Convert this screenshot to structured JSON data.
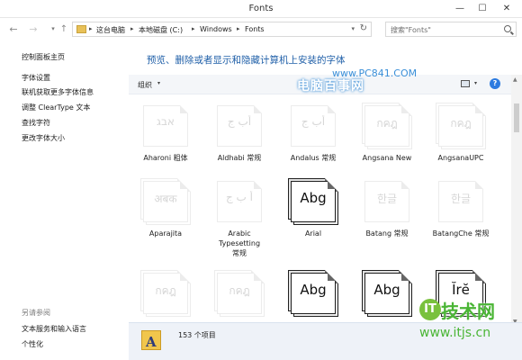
{
  "window": {
    "title": "Fonts",
    "minimize_glyph": "—",
    "maximize_glyph": "☐",
    "close_glyph": "✕"
  },
  "nav": {
    "back_glyph": "←",
    "forward_glyph": "→",
    "recent_glyph": "▾",
    "up_glyph": "↑",
    "breadcrumb": [
      "这台电脑",
      "本地磁盘 (C:)",
      "Windows",
      "Fonts"
    ],
    "separator_glyph": "▸",
    "dropdown_glyph": "▾",
    "refresh_glyph": "↻",
    "search_placeholder": "搜索\"Fonts\""
  },
  "sidebar": {
    "links": [
      "控制面板主页",
      "字体设置",
      "联机获取更多字体信息",
      "调整 ClearType 文本",
      "查找字符",
      "更改字体大小"
    ],
    "see_also_heading": "另请参阅",
    "see_also_links": [
      "文本服务和输入语言",
      "个性化"
    ]
  },
  "main": {
    "heading": "预览、删除或者显示和隐藏计算机上安装的字体",
    "organize_label": "组织",
    "organize_caret": "▾",
    "view_caret": "▾",
    "help_glyph": "?"
  },
  "scrollbar": {
    "up_glyph": "▲",
    "down_glyph": "▼"
  },
  "fonts": [
    {
      "name": "Aharoni 粗体",
      "sample": "אבג",
      "family_style": "single",
      "dim": true
    },
    {
      "name": "Aldhabi 常规",
      "sample": "أب ج",
      "family_style": "single",
      "dim": true
    },
    {
      "name": "Andalus 常规",
      "sample": "أب ج",
      "family_style": "single",
      "dim": true
    },
    {
      "name": "Angsana New",
      "sample": "กคฎ",
      "family_style": "stack",
      "dim": true
    },
    {
      "name": "AngsanaUPC",
      "sample": "กคฎ",
      "family_style": "stack",
      "dim": true
    },
    {
      "name": "Aparajita",
      "sample": "अबक",
      "family_style": "stack",
      "dim": true
    },
    {
      "name": "Arabic Typesetting 常规",
      "sample": "أ ب ج",
      "family_style": "single",
      "dim": true
    },
    {
      "name": "Arial",
      "sample": "Abg",
      "family_style": "dark",
      "dim": false
    },
    {
      "name": "Batang 常规",
      "sample": "한글",
      "family_style": "single",
      "dim": true
    },
    {
      "name": "BatangChe 常规",
      "sample": "한글",
      "family_style": "single",
      "dim": true
    },
    {
      "name": "",
      "sample": "กคฎ",
      "family_style": "stack",
      "dim": true
    },
    {
      "name": "",
      "sample": "กคฎ",
      "family_style": "stack",
      "dim": true
    },
    {
      "name": "",
      "sample": "Abg",
      "family_style": "dark",
      "dim": false
    },
    {
      "name": "",
      "sample": "Abg",
      "family_style": "dark",
      "dim": false
    },
    {
      "name": "",
      "sample": "Ĭrĕ",
      "family_style": "dark",
      "dim": false
    }
  ],
  "status": {
    "count_text": "153 个项目",
    "folder_letter": "A"
  },
  "watermarks": {
    "top_url": "www.PC841.COM",
    "top_text": "电脑百事网",
    "bottom_badge": "IT",
    "bottom_title": "技术网",
    "bottom_url": "www.itjs.cn"
  },
  "colors": {
    "heading": "#1f5fa8",
    "toolbar_bg": "#f4f6f9",
    "status_bg": "#eef2f8",
    "help_icon": "#2d7be0"
  }
}
